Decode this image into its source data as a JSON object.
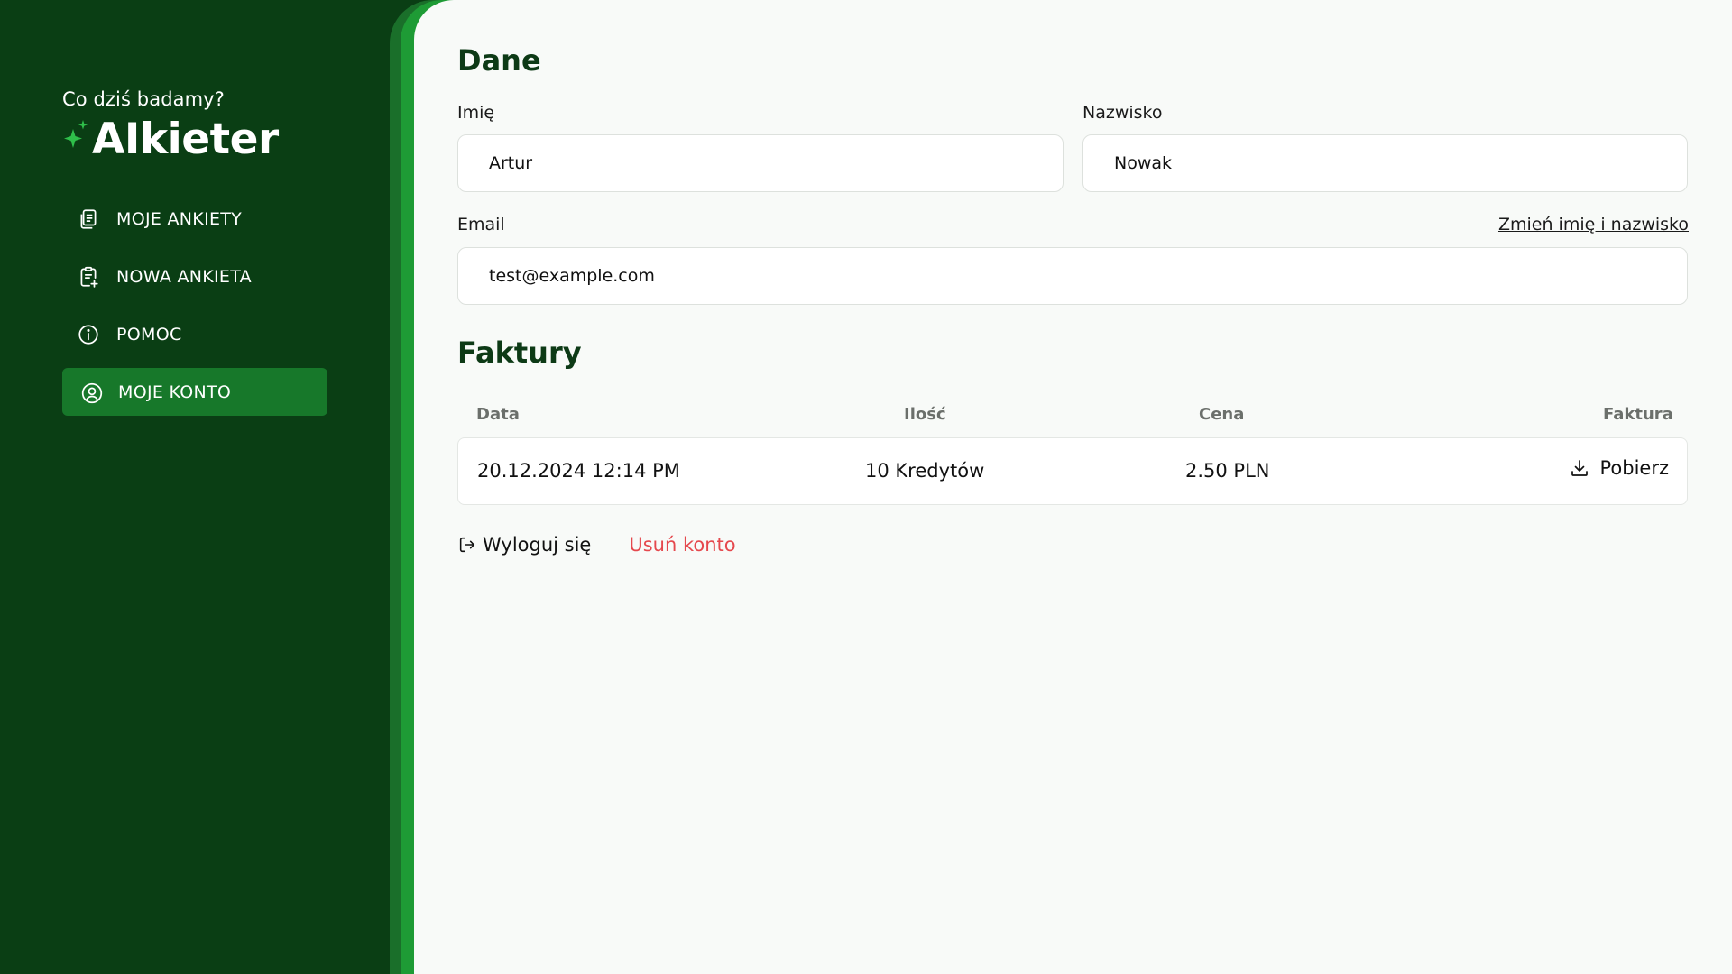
{
  "sidebar": {
    "tagline": "Co dziś badamy?",
    "brand": "AIkieter",
    "brand_icon": "sparkle-icon",
    "items": [
      {
        "label": "MOJE ANKIETY",
        "icon": "documents-icon",
        "active": false
      },
      {
        "label": "NOWA ANKIETA",
        "icon": "clipboard-add-icon",
        "active": false
      },
      {
        "label": "POMOC",
        "icon": "info-icon",
        "active": false
      },
      {
        "label": "MOJE KONTO",
        "icon": "user-circle-icon",
        "active": true
      }
    ]
  },
  "colors": {
    "sidebar_bg": "#0a3e14",
    "accent": "#1e9b35",
    "active_item": "#17782a",
    "sparkle": "#2fbf4a",
    "danger": "#e5484d"
  },
  "profile": {
    "section_title": "Dane",
    "first_name_label": "Imię",
    "first_name_value": "Artur",
    "last_name_label": "Nazwisko",
    "last_name_value": "Nowak",
    "email_label": "Email",
    "email_value": "test@example.com",
    "change_name_link": "Zmień imię i nazwisko"
  },
  "invoices": {
    "section_title": "Faktury",
    "columns": [
      "Data",
      "Ilość",
      "Cena",
      "Faktura"
    ],
    "rows": [
      {
        "date": "20.12.2024 12:14 PM",
        "amount": "10 Kredytów",
        "price": "2.50 PLN",
        "action": "Pobierz"
      }
    ]
  },
  "actions": {
    "logout": "Wyloguj się",
    "delete_account": "Usuń konto"
  }
}
